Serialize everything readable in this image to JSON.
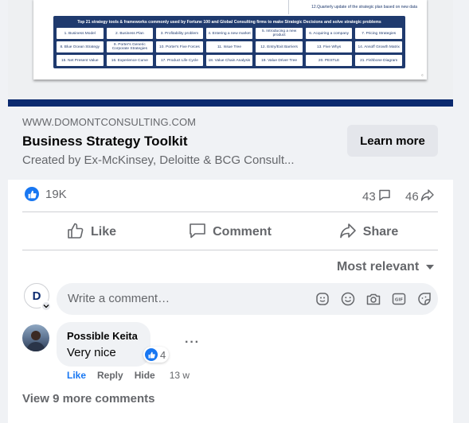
{
  "link_preview": {
    "image": {
      "note": "12.Quarterly update of the strategic plan based on new data",
      "grid_title": "Top 21 strategy tools & frameworks commonly used by Fortune 100 and Global Consulting firms to make Strategic Decisions and solve strategic problems",
      "tools": [
        "1. Business Model",
        "2. Business Plan",
        "3. Profitability problem",
        "4. Entering a new market",
        "5. Introducing a new product",
        "6. Acquiring a company",
        "7. Pricing Strategies",
        "8. Blue Ocean Strategy",
        "9. Porter's Generic Corporate Strategies",
        "10. Porter's Five Forces",
        "11. Issue Tree",
        "12. Entry/Exit Barriers",
        "13. Five Whys",
        "14. Ansoff Growth Matrix",
        "15. Net Present Value",
        "16. Experience Curve",
        "17. Product Life Cycle",
        "18. Value Chain Analysis",
        "19. Value Driver Tree",
        "20. PESTLE",
        "21. Fishbone Diagram"
      ],
      "mark": "©"
    },
    "domain": "WWW.DOMONTCONSULTING.COM",
    "title": "Business Strategy Toolkit",
    "description": "Created by Ex-McKinsey, Deloitte & BCG Consult...",
    "cta_label": "Learn more",
    "band_color": "#0b2a6f"
  },
  "stats": {
    "reactions_count": "19K",
    "comments_count": "43",
    "shares_count": "46"
  },
  "actions": {
    "like": "Like",
    "comment": "Comment",
    "share": "Share"
  },
  "comments": {
    "sort_label": "Most relevant",
    "input_placeholder": "Write a comment…",
    "my_avatar_letter": "D",
    "items": [
      {
        "author": "Possible Keita",
        "text": "Very nice",
        "reactions": "4",
        "like_label": "Like",
        "reply_label": "Reply",
        "hide_label": "Hide",
        "time": "13 w"
      }
    ],
    "more_dots": "···",
    "view_more": "View 9 more comments"
  },
  "icons": [
    "like-reaction-icon",
    "comment-bubble-icon",
    "share-arrow-icon",
    "thumbs-up-icon",
    "comment-icon",
    "share-icon",
    "caret-down-icon",
    "chevron-down-icon",
    "avatar-sticker-icon",
    "emoji-icon",
    "camera-icon",
    "gif-icon",
    "sticker-icon"
  ],
  "colors": {
    "accent": "#1877f2",
    "muted": "#65676b",
    "surface": "#f0f2f5"
  }
}
